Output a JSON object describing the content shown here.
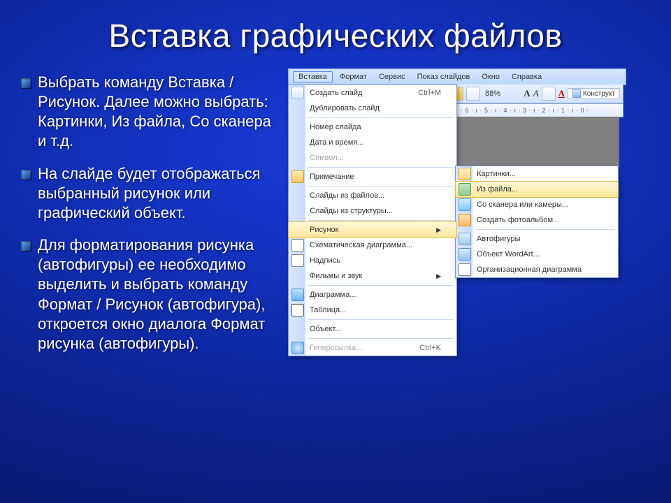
{
  "title": "Вставка графических файлов",
  "bullets": [
    "Выбрать команду Вставка / Рисунок. Далее можно выбрать: Картинки, Из файла, Со сканера и т.д.",
    "На слайде будет отображаться выбранный рисунок или графический объект.",
    " Для форматирования рисунка (автофигуры) ее необходимо выделить и выбрать команду Формат / Рисунок (автофигура), откроется окно диалога Формат рисунка (автофигуры)."
  ],
  "menubar": {
    "items": [
      "Вставка",
      "Формат",
      "Сервис",
      "Показ слайдов",
      "Окно",
      "Справка"
    ]
  },
  "toolbar": {
    "zoom": "88%",
    "designer": "Конструкт"
  },
  "ruler": "· 6 · ı · 5 · ı · 4 · ı · 3 · ı · 2 · ı · 1 · ı · 0 ·",
  "main_menu": [
    {
      "label": "Создать слайд",
      "shortcut": "Ctrl+M",
      "icon": "ic-new"
    },
    {
      "label": "Дублировать слайд"
    },
    {
      "sep": true
    },
    {
      "label": "Номер слайда"
    },
    {
      "label": "Дата и время..."
    },
    {
      "label": "Символ...",
      "dis": true
    },
    {
      "sep": true
    },
    {
      "label": "Примечание",
      "icon": "ic-fold"
    },
    {
      "sep": true
    },
    {
      "label": "Слайды из файлов..."
    },
    {
      "label": "Слайды из структуры..."
    },
    {
      "sep": true
    },
    {
      "label": "Рисунок",
      "sub": true,
      "hl": true
    },
    {
      "label": "Схематическая диаграмма...",
      "icon": "ic-diag"
    },
    {
      "label": "Надпись",
      "icon": "ic-txt"
    },
    {
      "label": "Фильмы и звук",
      "sub": true
    },
    {
      "sep": true
    },
    {
      "label": "Диаграмма...",
      "icon": "ic-chart"
    },
    {
      "label": "Таблица...",
      "icon": "ic-tab"
    },
    {
      "sep": true
    },
    {
      "label": "Объект..."
    },
    {
      "sep": true
    },
    {
      "label": "Гиперссылка...",
      "shortcut": "Ctrl+K",
      "icon": "ic-link",
      "dis": true
    }
  ],
  "sub_menu": [
    {
      "label": "Картинки...",
      "icon": "ic-clip"
    },
    {
      "label": "Из файла...",
      "icon": "ic-pic",
      "hl": true
    },
    {
      "label": "Со сканера или камеры...",
      "icon": "ic-scan"
    },
    {
      "label": "Создать фотоальбом...",
      "icon": "ic-album"
    },
    {
      "sep": true
    },
    {
      "label": "Автофигуры",
      "icon": "ic-shape"
    },
    {
      "label": "Объект WordArt...",
      "icon": "ic-wa"
    },
    {
      "label": "Организационная диаграмма",
      "icon": "ic-org"
    }
  ]
}
